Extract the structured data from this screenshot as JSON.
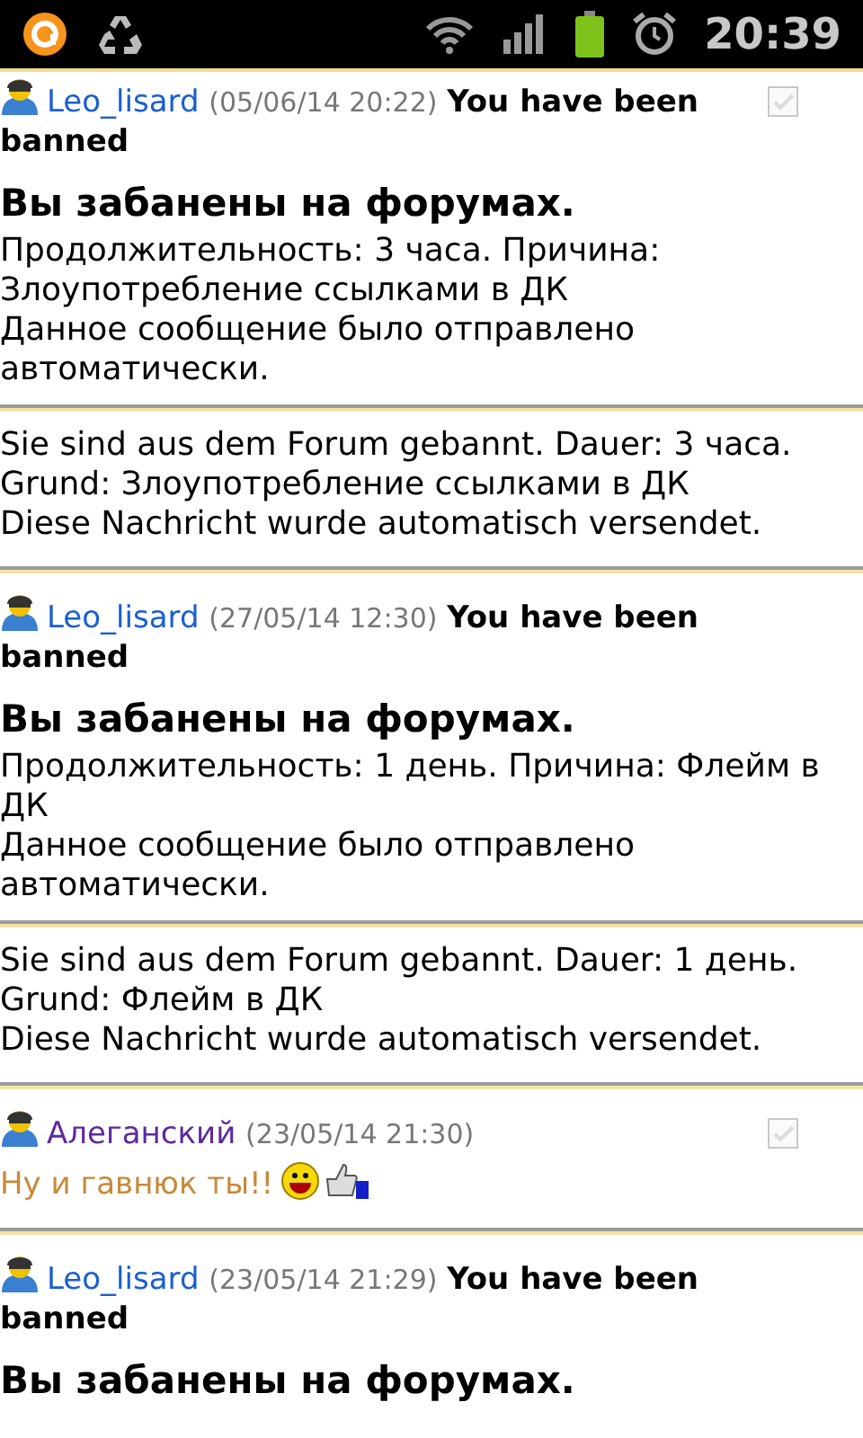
{
  "status_bar": {
    "time": "20:39"
  },
  "messages": [
    {
      "author": "Leo_lisard",
      "color": "#1a5fd0",
      "date": "(05/06/14 20:22)",
      "subject": "You have been banned",
      "checkbox": {
        "checked": false
      },
      "blocks": [
        {
          "kind": "heading",
          "text": "Вы забанены на форумах."
        },
        {
          "kind": "text",
          "text": "Продолжительность: 3 часа. Причина: Злоупотребление ссылками в ДК\nДанное сообщение было отправлено автоматически."
        },
        {
          "kind": "rule"
        },
        {
          "kind": "text",
          "text": "Sie sind aus dem Forum gebannt. Dauer: 3 часа.\nGrund: Злоупотребление ссылками в ДК\nDiese Nachricht wurde automatisch versendet."
        }
      ]
    },
    {
      "author": "Leo_lisard",
      "color": "#1a5fd0",
      "date": "(27/05/14 12:30)",
      "subject": "You have been banned",
      "blocks": [
        {
          "kind": "heading",
          "text": "Вы забанены на форумах."
        },
        {
          "kind": "text",
          "text": "Продолжительность: 1 день. Причина: Флейм в ДК\nДанное сообщение было отправлено автоматически."
        },
        {
          "kind": "rule"
        },
        {
          "kind": "text",
          "text": "Sie sind aus dem Forum gebannt. Dauer: 1 день.\nGrund: Флейм в ДК\nDiese Nachricht wurde automatisch versendet."
        }
      ]
    },
    {
      "author": "Алеганский",
      "color": "#5b2a9e",
      "date": "(23/05/14 21:30)",
      "checkbox": {
        "checked": false
      },
      "blocks": [
        {
          "kind": "comment",
          "text": "Ну и гавнюк ты!!",
          "color": "#c8893a"
        }
      ]
    },
    {
      "author": "Leo_lisard",
      "color": "#1a5fd0",
      "date": "(23/05/14 21:29)",
      "subject": "You have been banned",
      "blocks": [
        {
          "kind": "heading",
          "text": "Вы забанены на форумах."
        }
      ]
    }
  ]
}
